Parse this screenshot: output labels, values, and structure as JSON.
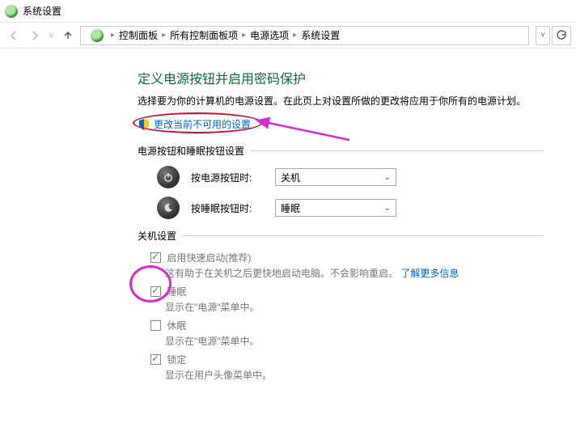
{
  "window": {
    "title": "系统设置"
  },
  "breadcrumb": {
    "items": [
      "控制面板",
      "所有控制面板项",
      "电源选项",
      "系统设置"
    ]
  },
  "page": {
    "heading": "定义电源按钮并启用密码保护",
    "description": "选择要为你的计算机的电源设置。在此页上对设置所做的更改将应用于你所有的电源计划。",
    "change_link": "更改当前不可用的设置"
  },
  "section_buttons": {
    "title": "电源按钮和睡眠按钮设置",
    "rows": [
      {
        "label": "按电源按钮时:",
        "value": "关机",
        "icon": "power"
      },
      {
        "label": "按睡眠按钮时:",
        "value": "睡眠",
        "icon": "moon"
      }
    ]
  },
  "section_shutdown": {
    "title": "关机设置",
    "items": [
      {
        "label": "启用快速启动(推荐)",
        "desc_prefix": "这有助于在关机之后更快地启动电脑。不会影响重启。",
        "checked": true,
        "learn_more": "了解更多信息"
      },
      {
        "label": "睡眠",
        "desc": "显示在\"电源\"菜单中。",
        "checked": true
      },
      {
        "label": "休眠",
        "desc": "显示在\"电源\"菜单中。",
        "checked": false
      },
      {
        "label": "锁定",
        "desc": "显示在用户头像菜单中。",
        "checked": true
      }
    ]
  }
}
